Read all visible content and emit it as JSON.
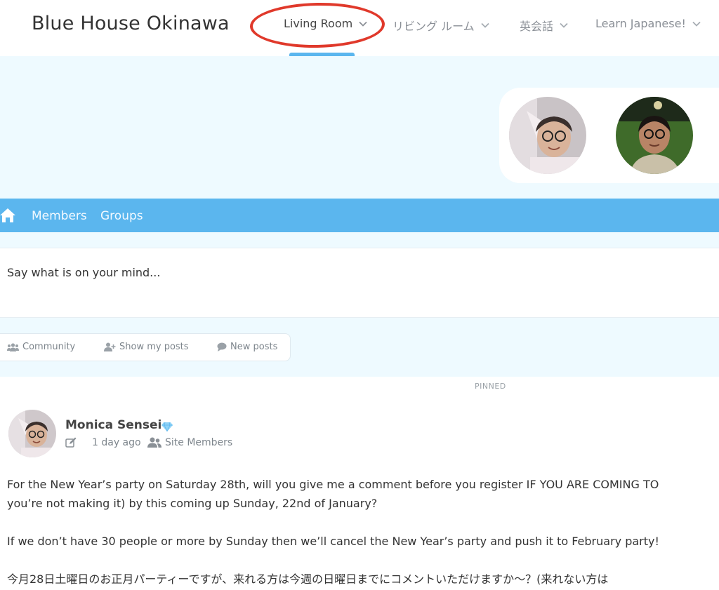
{
  "header": {
    "site_title": "Blue House Okinawa",
    "nav": [
      {
        "label": "Living Room",
        "active": true
      },
      {
        "label": "リビング ルーム",
        "active": false
      },
      {
        "label": "英会話",
        "active": false
      },
      {
        "label": "Learn Japanese!",
        "active": false
      }
    ]
  },
  "subnav": {
    "home_icon": "home-icon",
    "links": [
      "Members",
      "Groups"
    ]
  },
  "composer": {
    "placeholder": "Say what is on your mind..."
  },
  "filters": [
    {
      "icon": "community-icon",
      "label": "Community"
    },
    {
      "icon": "user-plus-icon",
      "label": "Show my posts"
    },
    {
      "icon": "comment-icon",
      "label": "New posts"
    }
  ],
  "post": {
    "pinned_label": "PINNED",
    "author": "Monica Sensei",
    "badge_icon": "diamond-icon",
    "time": "1 day ago",
    "audience": "Site Members",
    "lines": [
      "For the New Year’s party on Saturday 28th, will you give me a comment before you register IF YOU ARE COMING TO",
      "you’re not making it) by this coming up Sunday, 22nd of January?",
      "If we don’t have 30 people or more by Sunday then we’ll cancel the New Year’s party and push it to February party!",
      "今月28日土曜日のお正月パーティーですが、来れる方は今週の日曜日までにコメントいただけますか〜？(来れない方は"
    ]
  },
  "colors": {
    "accent_blue": "#5bb6ee",
    "light_bg": "#eefaff",
    "annotation_red": "#e0392b"
  }
}
